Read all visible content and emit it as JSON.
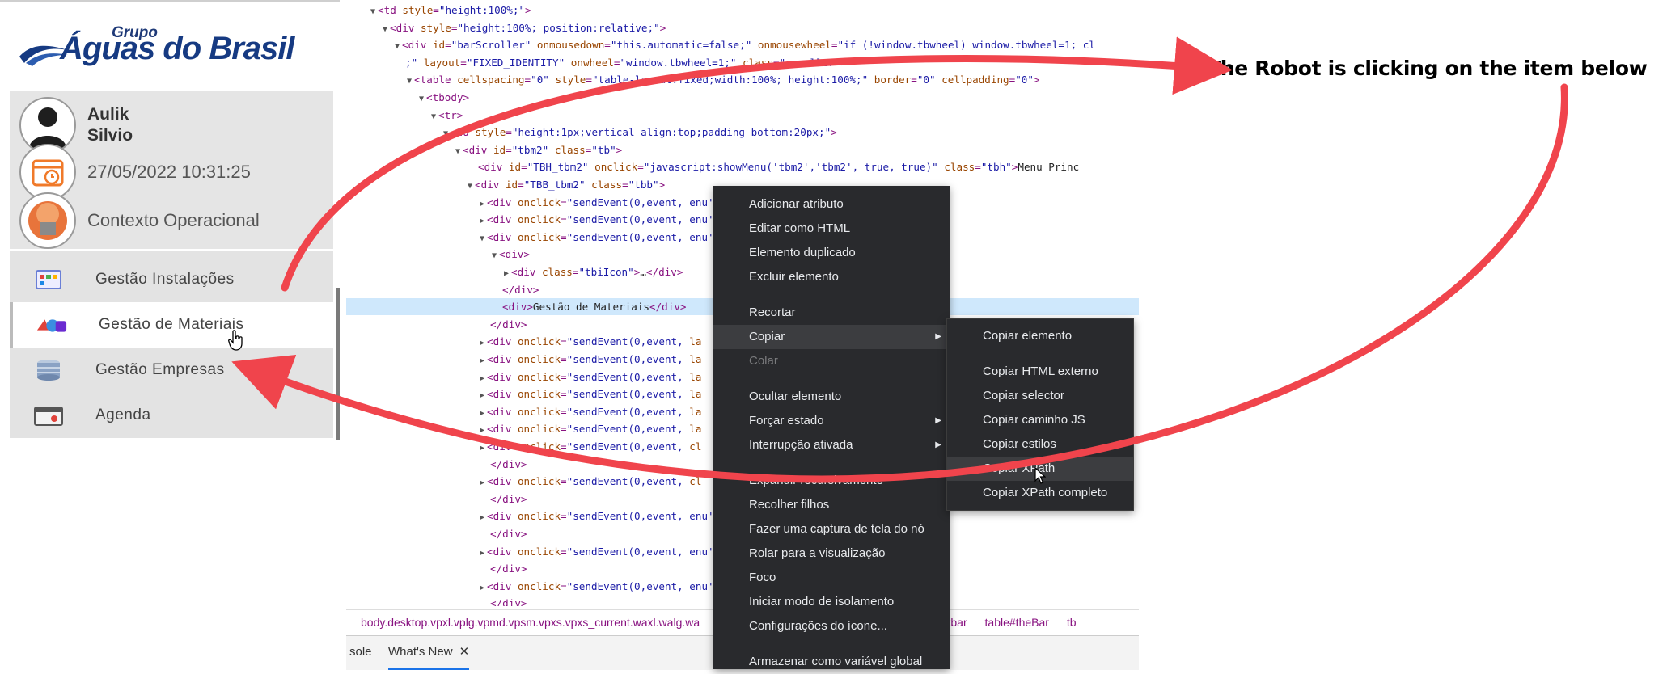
{
  "app": {
    "logo": {
      "grupo": "Grupo",
      "brand": "Águas do Brasil"
    },
    "user": {
      "first": "Aulik",
      "last": "Silvio"
    },
    "datetime": "27/05/2022 10:31:25",
    "context": "Contexto Operacional",
    "menu": [
      {
        "label": "Gestão Instalações",
        "icon": "installations-icon"
      },
      {
        "label": "Gestão de Materiais",
        "icon": "materials-icon",
        "active": true
      },
      {
        "label": "Gestão Empresas",
        "icon": "companies-icon"
      },
      {
        "label": "Agenda",
        "icon": "calendar-icon"
      }
    ]
  },
  "devtools": {
    "breadcrumb": [
      "body.desktop.vpxl.vplg.vpmd.vpsm.vpxs.vpxs_current.waxl.walg.wa",
      "div#clientbar",
      "table#theBar",
      "tb"
    ],
    "drawer_tabs": [
      "sole",
      "What's New"
    ]
  },
  "context_menu": {
    "items": [
      "Adicionar atributo",
      "Editar como HTML",
      "Elemento duplicado",
      "Excluir elemento",
      "Recortar",
      "Copiar",
      "Colar",
      "Ocultar elemento",
      "Forçar estado",
      "Interrupção ativada",
      "Expandir recursivamente",
      "Recolher filhos",
      "Fazer uma captura de tela do nó",
      "Rolar para a visualização",
      "Foco",
      "Iniciar modo de isolamento",
      "Configurações do ícone...",
      "Armazenar como variável global"
    ],
    "submenu": [
      "Copiar elemento",
      "Copiar HTML externo",
      "Copiar selector",
      "Copiar caminho JS",
      "Copiar estilos",
      "Copiar XPath",
      "Copiar XPath completo"
    ]
  },
  "annotation": "The Robot is clicking on the item below",
  "colors": {
    "arrow": "#f0444c",
    "brand_blue": "#163a82",
    "menu_bg": "#292a2d"
  }
}
